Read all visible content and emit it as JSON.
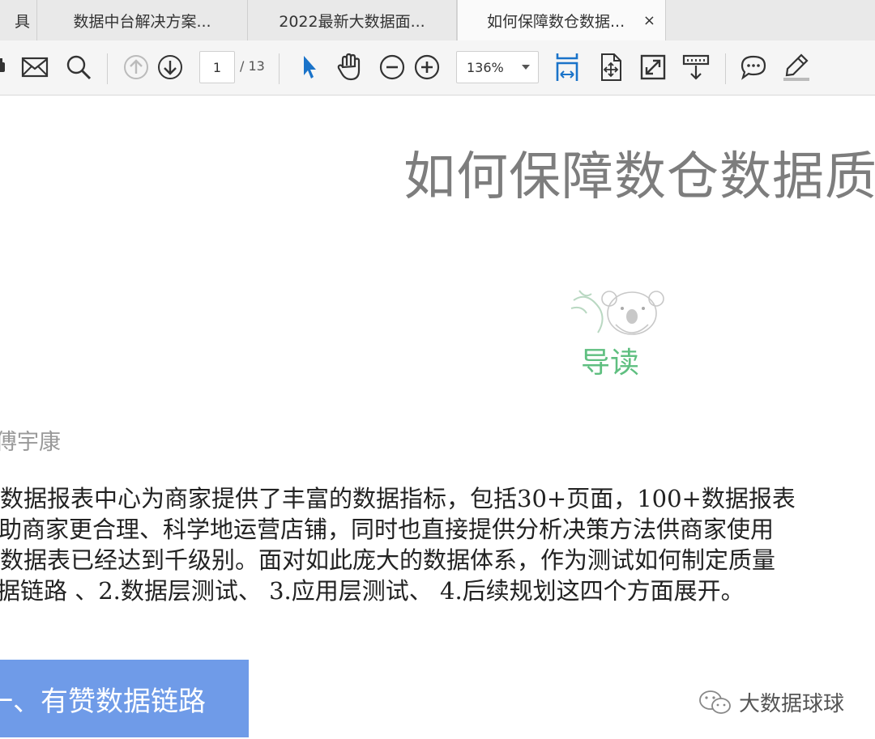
{
  "tabs": [
    {
      "label": "具",
      "active": false
    },
    {
      "label": "数据中台解决方案...",
      "active": false
    },
    {
      "label": "2022最新大数据面...",
      "active": false
    },
    {
      "label": "如何保障数仓数据...",
      "active": true,
      "close": "×"
    }
  ],
  "toolbar": {
    "icons": [
      "print-icon",
      "mail-icon",
      "search-icon",
      "prev-page-icon",
      "next-page-icon",
      "select-arrow-icon",
      "hand-tool-icon",
      "zoom-out-icon",
      "zoom-in-icon",
      "fit-width-icon",
      "rotate-icon",
      "fullscreen-icon",
      "scroll-mode-icon",
      "comment-icon",
      "highlight-icon"
    ],
    "page_current": "1",
    "page_total": "/ 13",
    "zoom": "136%"
  },
  "document": {
    "title": "如何保障数仓数据质量",
    "lead_label": "导读",
    "author": "傅宇康",
    "paragraph_lines": [
      "数据报表中心为商家提供了丰富的数据指标，包括30+页面，100+数据报表",
      "助商家更合理、科学地运营店铺，同时也直接提供分析决策方法供商家使用",
      "数据表已经达到千级别。面对如此庞大的数据体系，作为测试如何制定质量",
      "据链路 、2.数据层测试、 3.应用层测试、 4.后续规划这四个方面展开。"
    ],
    "section_heading": "一、有赞数据链路",
    "watermark": "大数据球球"
  },
  "colors": {
    "accent_blue": "#1a73c9",
    "section_bg": "#6f9be8",
    "lead_green": "#5fbf80"
  }
}
